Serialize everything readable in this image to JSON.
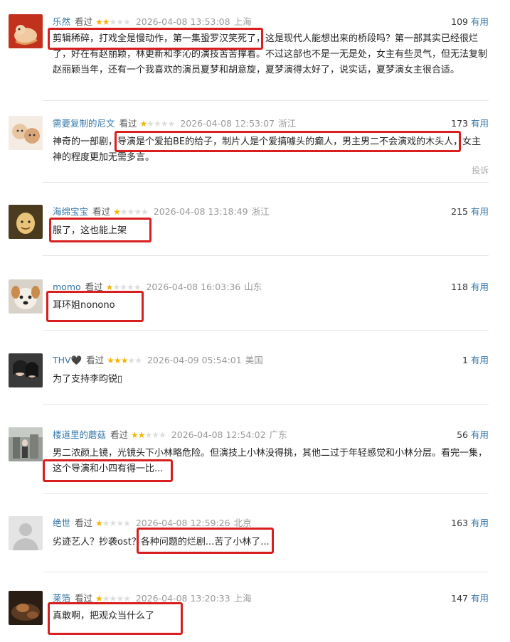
{
  "useful_label": "有用",
  "watched_label": "看过",
  "colors": {
    "username": "#3377aa",
    "highlight": "#d81e1e",
    "star": "#f4b400"
  },
  "comments": [
    {
      "user": "乐然",
      "rating": 2,
      "time": "2026-04-08 13:53:08",
      "location": "上海",
      "votes": "109",
      "lines": [
        "剪辑稀碎，打戏全是慢动作，第一集蛩罗汉笑死了，这是现代人能想出来的桥段吗？第一部其实已经很烂",
        "了，好在有赵丽颖，林更新和李沁的演技苦苦撑着。不过这部也不是一无是处，女主有些灵气，但无法复制",
        "赵丽颖当年，还有一个我喜欢的演员夏梦和胡意旋，夏梦演得太好了，说实话，夏梦演女主很合适。"
      ]
    },
    {
      "user": "需要复制的尼文",
      "rating": 1,
      "time": "2026-04-08 12:53:07",
      "location": "浙江",
      "votes": "173",
      "lines": [
        "神奇的一部剧，导演是个爱拍BE的给子，制片人是个爱搞噱头的癫人，男主男二不会演戏的木头人，女主",
        "神的程度更加无需多言。"
      ],
      "report": "投诉"
    },
    {
      "user": "海绵宝宝",
      "rating": 1,
      "time": "2026-04-08 13:18:49",
      "location": "浙江",
      "votes": "215",
      "lines": [
        "服了，这也能上架"
      ]
    },
    {
      "user": "momo",
      "rating": 1,
      "time": "2026-04-08 16:03:36",
      "location": "山东",
      "votes": "118",
      "lines": [
        "耳环姐nonono"
      ]
    },
    {
      "user": "THV🖤",
      "rating": 3,
      "time": "2026-04-09 05:54:01",
      "location": "美国",
      "votes": "1",
      "lines": [
        "为了支持李昀锐▯"
      ]
    },
    {
      "user": "楼道里的蘑菇",
      "rating": 2,
      "time": "2026-04-08 12:54:02",
      "location": "广东",
      "votes": "56",
      "lines": [
        "男二浓颜上镜，光镜头下小林略危险。但演技上小林没得挑，其他二过于年轻感觉和小林分层。看完一集，",
        "这个导演和小四有得一比..."
      ]
    },
    {
      "user": "绝世",
      "rating": 1,
      "time": "2026-04-08 12:59:26",
      "location": "北京",
      "votes": "163",
      "lines": [
        "劣迹艺人？抄袭ost？各种问题的烂剧...苦了小林了..."
      ]
    },
    {
      "user": "莱箔",
      "rating": 1,
      "time": "2026-04-08 13:20:33",
      "location": "上海",
      "votes": "147",
      "lines": [
        "真敢啊，把观众当什么了"
      ]
    }
  ]
}
